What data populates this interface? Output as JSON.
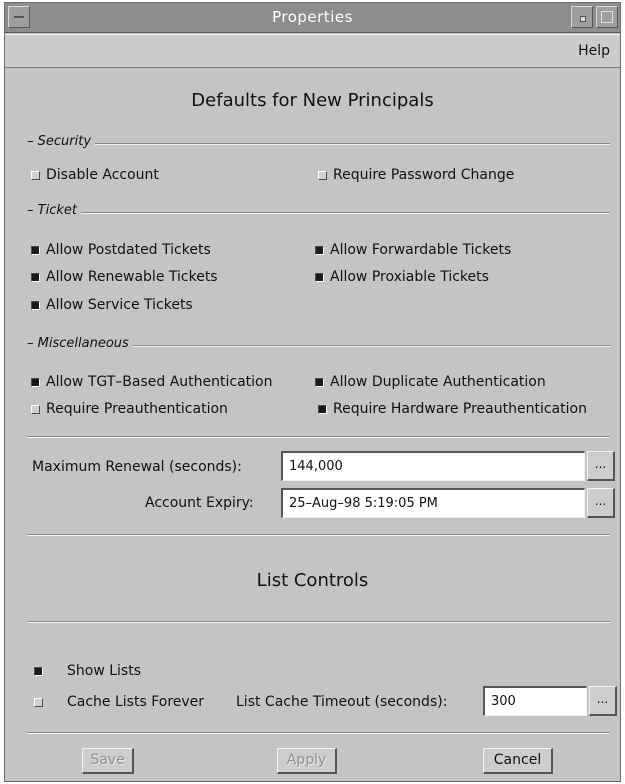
{
  "window": {
    "title": "Properties"
  },
  "menubar": {
    "help_label": "Help"
  },
  "defaults_heading": "Defaults for New Principals",
  "security": {
    "label": "Security",
    "items": [
      {
        "label": "Disable Account",
        "checked": false
      },
      {
        "label": "Require Password Change",
        "checked": false
      }
    ]
  },
  "ticket": {
    "label": "Ticket",
    "items": [
      {
        "label": "Allow Postdated Tickets",
        "checked": true
      },
      {
        "label": "Allow Forwardable Tickets",
        "checked": true
      },
      {
        "label": "Allow Renewable Tickets",
        "checked": true
      },
      {
        "label": "Allow Proxiable Tickets",
        "checked": true
      },
      {
        "label": "Allow Service Tickets",
        "checked": true
      }
    ]
  },
  "misc": {
    "label": "Miscellaneous",
    "items": [
      {
        "label": "Allow TGT–Based Authentication",
        "checked": true
      },
      {
        "label": "Allow Duplicate Authentication",
        "checked": true
      },
      {
        "label": "Require Preauthentication",
        "checked": false
      },
      {
        "label": "Require Hardware Preauthentication",
        "checked": true
      }
    ]
  },
  "fields": {
    "max_renewal": {
      "label": "Maximum Renewal (seconds):",
      "value": "144,000"
    },
    "account_expiry": {
      "label": "Account Expiry:",
      "value": "25–Aug–98 5:19:05 PM"
    },
    "ellipsis_label": "..."
  },
  "list_controls": {
    "heading": "List Controls",
    "show_lists": {
      "label": "Show Lists",
      "checked": true
    },
    "cache_forever": {
      "label": "Cache Lists Forever",
      "checked": false
    },
    "timeout": {
      "label": "List Cache Timeout (seconds):",
      "value": "300"
    }
  },
  "buttons": {
    "save": "Save",
    "apply": "Apply",
    "cancel": "Cancel"
  }
}
